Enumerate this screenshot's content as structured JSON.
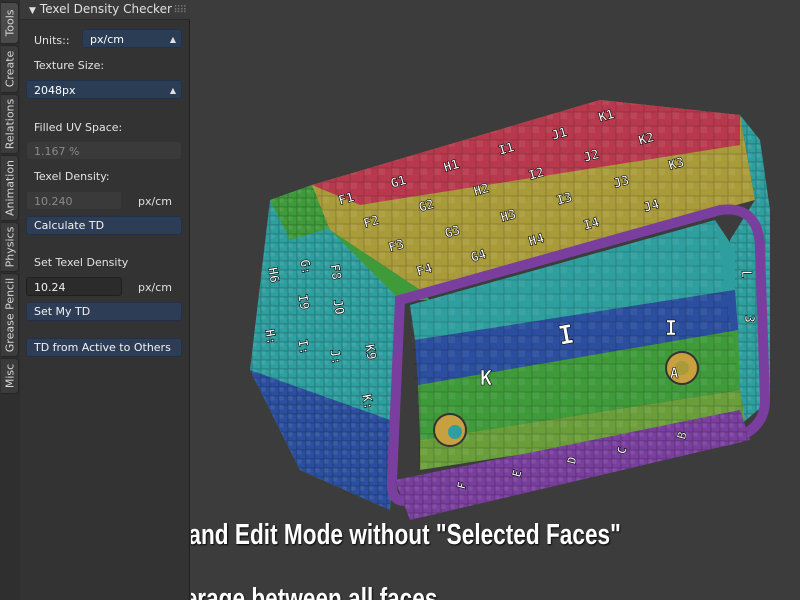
{
  "tabs": [
    {
      "label": "Tools"
    },
    {
      "label": "Create"
    },
    {
      "label": "Relations"
    },
    {
      "label": "Animation"
    },
    {
      "label": "Physics"
    },
    {
      "label": "Grease Pencil"
    },
    {
      "label": "Misc"
    }
  ],
  "panel": {
    "title": "Texel Density Checker",
    "units_label": "Units::",
    "units_value": "px/cm",
    "texture_size_label": "Texture Size:",
    "texture_size_value": "2048px",
    "filled_uv_label": "Filled UV Space:",
    "filled_uv_value": "1.167 %",
    "texel_density_label": "Texel Density:",
    "texel_density_value": "10.240",
    "texel_density_unit": "px/cm",
    "calculate_btn": "Calculate TD",
    "set_td_label": "Set Texel Density",
    "set_td_value": "10.24",
    "set_td_unit": "px/cm",
    "set_my_td_btn": "Set My TD",
    "td_active_btn": "TD from Active to Others"
  },
  "viewport": {
    "top_row_labels": [
      "K1",
      "J1",
      "I1",
      "H1",
      "G1",
      "F1"
    ],
    "row2_labels": [
      "K2",
      "J2",
      "I2",
      "H2",
      "G2",
      "F2"
    ],
    "row3_labels": [
      "K3",
      "J3",
      "I3",
      "H3",
      "G3",
      "F3"
    ],
    "row4_labels": [
      "J4",
      "I4",
      "H4",
      "G4",
      "F4"
    ],
    "side_labels": [
      "H6",
      "G:",
      "F8",
      "I9",
      "J0",
      "K9",
      "H:",
      "I:",
      "J:",
      "K:"
    ],
    "inner_labels": [
      "L",
      "I",
      "A",
      "3",
      "K",
      "I",
      "C",
      "D",
      "E",
      "F",
      "B"
    ],
    "colors": {
      "red": "#b8394e",
      "yellow": "#a99b3a",
      "teal": "#2e9e9e",
      "blue": "#2b4f9e",
      "green": "#3f9a3a",
      "purple": "#7a3f9e"
    }
  },
  "caption": "In Object Mode and Edit Mode without \"Selected Faces\" will be\ncalculate TD average between all faces"
}
